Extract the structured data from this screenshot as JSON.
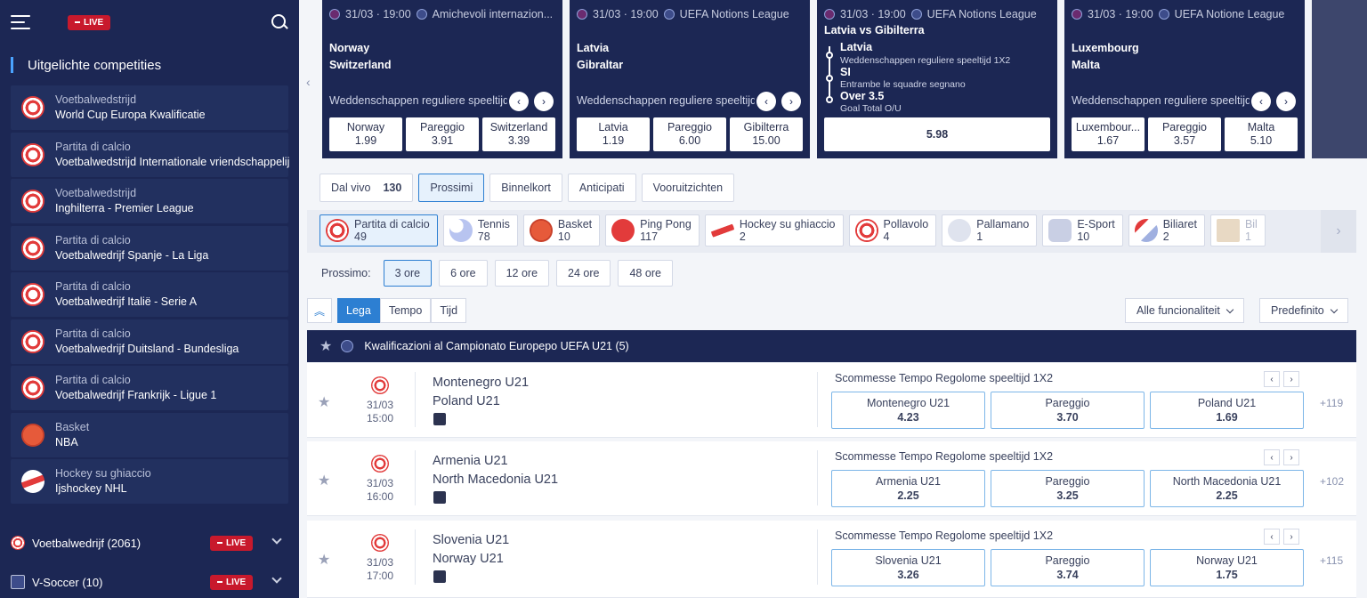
{
  "sidebar": {
    "live_label": "LIVE",
    "section_title": "Uitgelichte competities",
    "competitions": [
      {
        "sport": "Voetbalwedstrijd",
        "name": "World Cup Europa Kwalificatie",
        "icon": "soccer-ball-icon"
      },
      {
        "sport": "Partita di calcio",
        "name": "Voetbalwedstrijd Internationale vriendschappelij",
        "icon": "soccer-ball-icon"
      },
      {
        "sport": "Voetbalwedstrijd",
        "name": "Inghilterra - Premier League",
        "icon": "soccer-ball-icon"
      },
      {
        "sport": "Partita di calcio",
        "name": "Voetbalwedrijf Spanje - La Liga",
        "icon": "soccer-ball-icon"
      },
      {
        "sport": "Partita di calcio",
        "name": "Voetbalwedrijf Italiё - Serie A",
        "icon": "soccer-ball-icon"
      },
      {
        "sport": "Partita di calcio",
        "name": "Voetbalwedrijf Duitsland - Bundesliga",
        "icon": "soccer-ball-icon"
      },
      {
        "sport": "Partita di calcio",
        "name": "Voetbalwedrijf Frankrijk - Ligue 1",
        "icon": "soccer-ball-icon"
      },
      {
        "sport": "Basket",
        "name": "NBA",
        "icon": "basketball-icon"
      },
      {
        "sport": "Hockey su ghiaccio",
        "name": "Ijshockey NHL",
        "icon": "hockey-puck-icon"
      }
    ],
    "sports": [
      {
        "label": "Voetbalwedrijf (2061)",
        "live": "LIVE"
      },
      {
        "label": "V-Soccer  (10)",
        "live": "LIVE"
      }
    ]
  },
  "featured": [
    {
      "header": "31/03 · 19:00",
      "league": "Amichevoli internazion...",
      "team1": "Norway",
      "team2": "Switzerland",
      "market": "Weddenschappen reguliere speeltijd",
      "odds": [
        {
          "label": "Norway",
          "value": "1.99"
        },
        {
          "label": "Pareggio",
          "value": "3.91"
        },
        {
          "label": "Switzerland",
          "value": "3.39"
        }
      ]
    },
    {
      "header": "31/03 · 19:00",
      "league": "UEFA Notions League",
      "team1": "Latvia",
      "team2": "Gibraltar",
      "market": "Weddenschappen reguliere speeltijd",
      "odds": [
        {
          "label": "Latvia",
          "value": "1.19"
        },
        {
          "label": "Pareggio",
          "value": "6.00"
        },
        {
          "label": "Gibilterra",
          "value": "15.00"
        }
      ]
    },
    {
      "header": "31/03 · 19:00",
      "league": "UEFA Notions League",
      "title": "Latvia vs Gibilterra",
      "lines": [
        {
          "bold": "Latvia",
          "sub": "Weddenschappen reguliere speeltijd 1X2"
        },
        {
          "bold": "SI",
          "sub": "Entrambe le squadre segnano"
        },
        {
          "bold": "Over 3.5",
          "sub": "Goal Total O/U"
        }
      ],
      "total": "5.98"
    },
    {
      "header": "31/03 · 19:00",
      "league": "UEFA Notione League",
      "team1": "Luxembourg",
      "team2": "Malta",
      "market": "Weddenschappen reguliere speeltijd",
      "odds": [
        {
          "label": "Luxembour...",
          "value": "1.67"
        },
        {
          "label": "Pareggio",
          "value": "3.57"
        },
        {
          "label": "Malta",
          "value": "5.10"
        }
      ]
    }
  ],
  "filter_tabs": [
    {
      "label": "Dal vivo",
      "count": "130"
    },
    {
      "label": "Prossimi",
      "count": ""
    },
    {
      "label": "Binnelkort",
      "count": ""
    },
    {
      "label": "Anticipati",
      "count": ""
    },
    {
      "label": "Vooruitzichten",
      "count": ""
    }
  ],
  "sports_strip": [
    {
      "name": "Partita di calcio",
      "count": "49"
    },
    {
      "name": "Tennis",
      "count": "78"
    },
    {
      "name": "Basket",
      "count": "10"
    },
    {
      "name": "Ping Pong",
      "count": "117"
    },
    {
      "name": "Hockey su ghiaccio",
      "count": "2"
    },
    {
      "name": "Pollavolo",
      "count": "4"
    },
    {
      "name": "Pallamano",
      "count": "1"
    },
    {
      "name": "E-Sport",
      "count": "10"
    },
    {
      "name": "Biliaret",
      "count": "2"
    },
    {
      "name": "Bil",
      "count": "1"
    }
  ],
  "prossimo": {
    "label": "Prossimo:",
    "options": [
      "3 ore",
      "6 ore",
      "12 ore",
      "24 ore",
      "48 ore"
    ]
  },
  "sort": {
    "options": [
      "Lega",
      "Tempo",
      "Tijd"
    ],
    "filter1": "Alle funcionaliteit",
    "filter2": "Predefinito"
  },
  "league": {
    "name": "Kwalificazioni al Campionato Europepo UEFA U21 (5)"
  },
  "matches": [
    {
      "date": "31/03",
      "time": "15:00",
      "team1": "Montenegro U21",
      "team2": "Poland U21",
      "market": "Scommesse Tempo Regolome speeltijd 1X2",
      "odds": [
        {
          "label": "Montenegro U21",
          "value": "4.23"
        },
        {
          "label": "Pareggio",
          "value": "3.70"
        },
        {
          "label": "Poland U21",
          "value": "1.69"
        }
      ],
      "more": "+119"
    },
    {
      "date": "31/03",
      "time": "16:00",
      "team1": "Armenia U21",
      "team2": "North Macedonia U21",
      "market": "Scommesse Tempo Regolome speeltijd 1X2",
      "odds": [
        {
          "label": "Armenia U21",
          "value": "2.25"
        },
        {
          "label": "Pareggio",
          "value": "3.25"
        },
        {
          "label": "North Macedonia U21",
          "value": "2.25"
        }
      ],
      "more": "+102"
    },
    {
      "date": "31/03",
      "time": "17:00",
      "team1": "Slovenia U21",
      "team2": "Norway U21",
      "market": "Scommesse Tempo Regolome speeltijd 1X2",
      "odds": [
        {
          "label": "Slovenia U21",
          "value": "3.26"
        },
        {
          "label": "Pareggio",
          "value": "3.74"
        },
        {
          "label": "Norway U21",
          "value": "1.75"
        }
      ],
      "more": "+115"
    }
  ],
  "colors": {
    "navy": "#1c2754",
    "accent": "#2d7fd2",
    "live": "#c8192c"
  }
}
